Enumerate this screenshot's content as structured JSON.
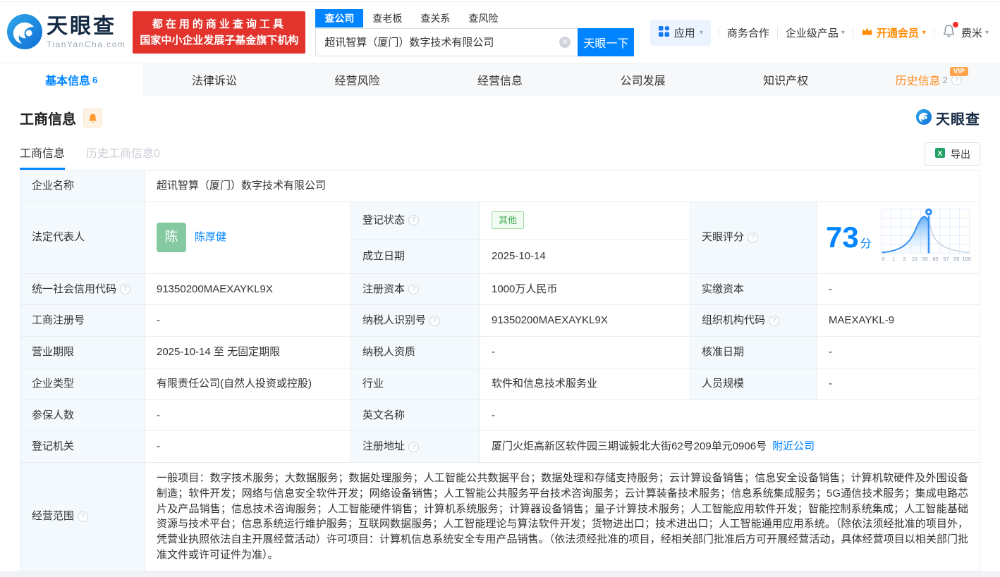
{
  "header": {
    "logo": {
      "name": "天眼查",
      "domain": "TianYanCha.com"
    },
    "slogan": {
      "line1": "都在用的商业查询工具",
      "line2": "国家中小企业发展子基金旗下机构"
    },
    "search": {
      "tabs": {
        "company": "查公司",
        "boss": "查老板",
        "relation": "查关系",
        "risk": "查风险"
      },
      "value": "超讯智算（厦门）数字技术有限公司",
      "button": "天眼一下"
    },
    "nav": {
      "apps": "应用",
      "cooperation": "商务合作",
      "enterprise": "企业级产品",
      "vip": "开通会员",
      "user": "费米"
    }
  },
  "main_tabs": {
    "basic": {
      "label": "基本信息",
      "count": "6"
    },
    "legal": {
      "label": "法律诉讼"
    },
    "risk": {
      "label": "经营风险"
    },
    "operation": {
      "label": "经营信息"
    },
    "development": {
      "label": "公司发展"
    },
    "ip": {
      "label": "知识产权"
    },
    "history": {
      "label": "历史信息",
      "count": "2",
      "badge": "VIP"
    }
  },
  "section": {
    "title": "工商信息",
    "subtab_active": "工商信息",
    "subtab_inactive": "历史工商信息0",
    "export": "导出",
    "watermark": "天眼查"
  },
  "info": {
    "name_label": "企业名称",
    "name": "超讯智算（厦门）数字技术有限公司",
    "legal_label": "法定代表人",
    "legal_avatar": "陈",
    "legal_name": "陈厚健",
    "status_label": "登记状态",
    "status": "其他",
    "established_label": "成立日期",
    "established": "2025-10-14",
    "score_label": "天眼评分",
    "score": "73",
    "score_unit": "分"
  },
  "fields": {
    "credit_code": {
      "label": "统一社会信用代码",
      "value": "91350200MAEXAYKL9X"
    },
    "reg_capital": {
      "label": "注册资本",
      "value": "1000万人民币"
    },
    "paid_capital": {
      "label": "实缴资本",
      "value": "-"
    },
    "reg_number": {
      "label": "工商注册号",
      "value": "-"
    },
    "taxpayer_id": {
      "label": "纳税人识别号",
      "value": "91350200MAEXAYKL9X"
    },
    "org_code": {
      "label": "组织机构代码",
      "value": "MAEXAYKL-9"
    },
    "business_term": {
      "label": "营业期限",
      "value": "2025-10-14 至 无固定期限"
    },
    "taxpayer_quality": {
      "label": "纳税人资质",
      "value": "-"
    },
    "approval_date": {
      "label": "核准日期",
      "value": "-"
    },
    "company_type": {
      "label": "企业类型",
      "value": "有限责任公司(自然人投资或控股)"
    },
    "industry": {
      "label": "行业",
      "value": "软件和信息技术服务业"
    },
    "staff_size": {
      "label": "人员规模",
      "value": "-"
    },
    "insured_count": {
      "label": "参保人数",
      "value": "-"
    },
    "english_name": {
      "label": "英文名称",
      "value": "-"
    },
    "reg_authority": {
      "label": "登记机关",
      "value": "-"
    },
    "reg_address": {
      "label": "注册地址",
      "value": "厦门火炬高新区软件园三期诚毅北大街62号209单元0906号",
      "link": "附近公司"
    },
    "business_scope": {
      "label": "经营范围",
      "value": "一般项目：数字技术服务；大数据服务；数据处理服务；人工智能公共数据平台；数据处理和存储支持服务；云计算设备销售；信息安全设备销售；计算机软硬件及外围设备制造；软件开发；网络与信息安全软件开发；网络设备销售；人工智能公共服务平台技术咨询服务；云计算装备技术服务；信息系统集成服务；5G通信技术服务；集成电路芯片及产品销售；信息技术咨询服务；人工智能硬件销售；计算机系统服务；计算器设备销售；量子计算技术服务；人工智能应用软件开发；智能控制系统集成；人工智能基础资源与技术平台；信息系统运行维护服务；互联网数据服务；人工智能理论与算法软件开发；货物进出口；技术进出口；人工智能通用应用系统。（除依法须经批准的项目外，凭营业执照依法自主开展经营活动）许可项目：计算机信息系统安全专用产品销售。（依法须经批准的项目，经相关部门批准后方可开展经营活动，具体经营项目以相关部门批准文件或许可证件为准）。"
    }
  },
  "score_chart": {
    "type": "area",
    "score": 73,
    "ticks": [
      "0",
      "1",
      "3",
      "15",
      "50",
      "85",
      "97",
      "99",
      "100"
    ],
    "accent_color": "#2f8df5"
  },
  "colors": {
    "brand_blue": "#0084ff",
    "brand_red": "#e2342d",
    "vip_orange": "#ff8a00",
    "tag_green": "#44ae53"
  }
}
